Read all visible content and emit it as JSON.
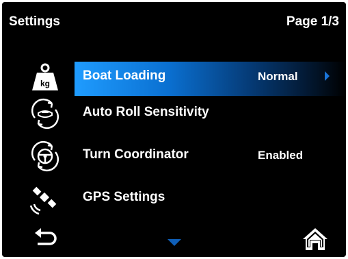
{
  "header": {
    "title": "Settings",
    "page_indicator": "Page 1/3"
  },
  "menu": [
    {
      "label": "Boat Loading",
      "value": "Normal",
      "icon": "weight-kg-icon",
      "selected": true,
      "icon_text": "kg"
    },
    {
      "label": "Auto Roll Sensitivity",
      "value": "",
      "icon": "auto-roll-icon",
      "selected": false
    },
    {
      "label": "Turn Coordinator",
      "value": "Enabled",
      "icon": "steering-wheel-icon",
      "selected": false
    },
    {
      "label": "GPS Settings",
      "value": "",
      "icon": "satellite-icon",
      "selected": false
    }
  ],
  "nav": {
    "back_icon": "back-icon",
    "scroll_icon": "scroll-down-icon",
    "home_icon": "home-icon"
  },
  "colors": {
    "background": "#000000",
    "highlight": "#1f9cff",
    "text": "#ffffff",
    "arrow": "#1a74d8"
  }
}
